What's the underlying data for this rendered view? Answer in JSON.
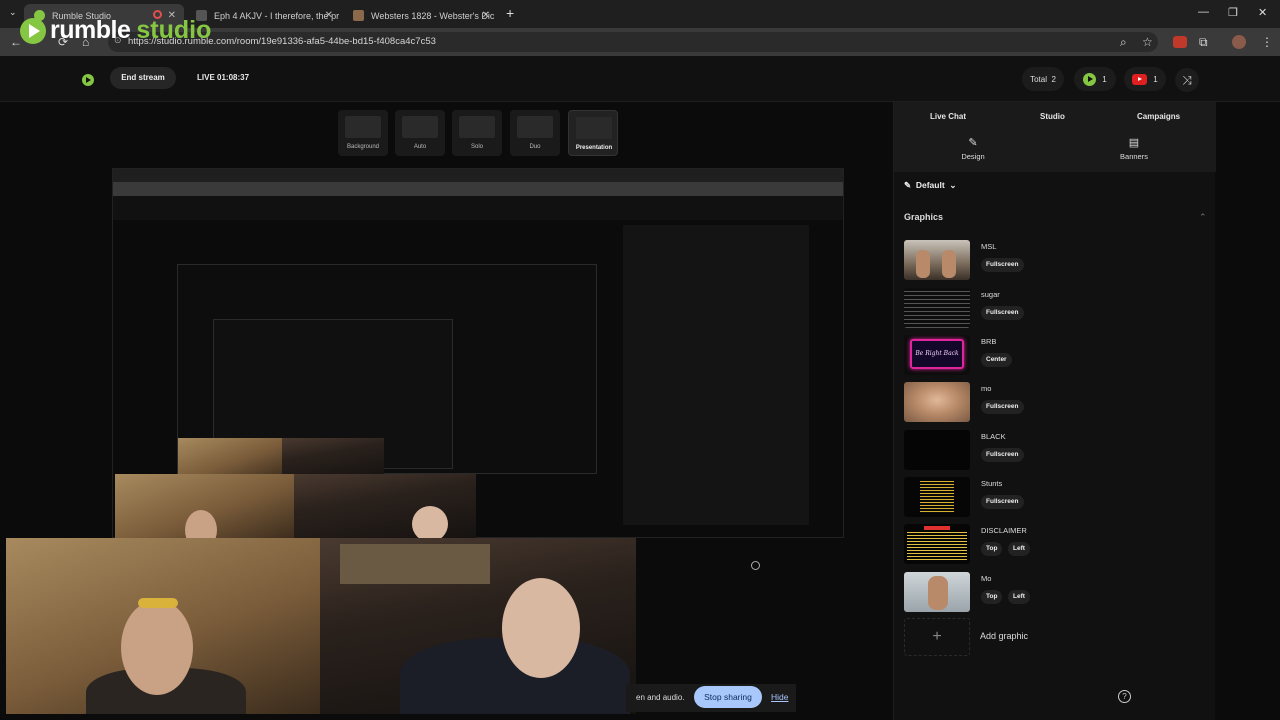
{
  "browser": {
    "tabs": [
      {
        "title": "Rumble Studio"
      },
      {
        "title": "Eph 4 AKJV - I therefore, the pr"
      },
      {
        "title": "Websters 1828 - Webster's Dic"
      }
    ],
    "url": "https://studio.rumble.com/room/19e91336-afa5-44be-bd15-f408ca4c7c53",
    "new_tab": "+",
    "window_controls": {
      "minimize": "—",
      "restore": "❐",
      "close": "✕"
    }
  },
  "overlay_logo": {
    "word1": "rumble",
    "word2": "studio"
  },
  "header": {
    "end_stream_label": "End stream",
    "live_label": "LIVE  01:08:37",
    "total_label": "Total",
    "total_count": "2",
    "rumble_count": "1",
    "youtube_count": "1"
  },
  "layouts": [
    {
      "label": "Background"
    },
    {
      "label": "Auto"
    },
    {
      "label": "Solo"
    },
    {
      "label": "Duo"
    },
    {
      "label": "Presentation",
      "selected": true
    }
  ],
  "sidebar": {
    "tabs": [
      {
        "label": "Live Chat"
      },
      {
        "label": "Studio"
      },
      {
        "label": "Campaigns"
      }
    ],
    "subtabs": [
      {
        "label": "Design",
        "icon": "pencil-icon"
      },
      {
        "label": "Banners",
        "icon": "banner-icon"
      }
    ],
    "theme_label": "Default",
    "graphics_heading": "Graphics",
    "graphics": [
      {
        "name": "MSL",
        "buttons": [
          "Fullscreen"
        ]
      },
      {
        "name": "sugar",
        "buttons": [
          "Fullscreen"
        ]
      },
      {
        "name": "BRB",
        "buttons": [
          "Center"
        ]
      },
      {
        "name": "mo",
        "buttons": [
          "Fullscreen"
        ]
      },
      {
        "name": "BLACK",
        "buttons": [
          "Fullscreen"
        ]
      },
      {
        "name": "Stunts",
        "buttons": [
          "Fullscreen"
        ]
      },
      {
        "name": "DISCLAIMER",
        "buttons": [
          "Top",
          "Left"
        ]
      },
      {
        "name": "Mo",
        "buttons": [
          "Top",
          "Left"
        ]
      }
    ],
    "add_graphic_label": "Add graphic",
    "brb_thumb_text": "Be Right Back"
  },
  "share_banner": {
    "text": "en and audio.",
    "stop_label": "Stop sharing",
    "hide_label": "Hide"
  },
  "colors": {
    "accent_green": "#85c742",
    "youtube_red": "#e02020",
    "brb_neon": "#e0249c"
  }
}
